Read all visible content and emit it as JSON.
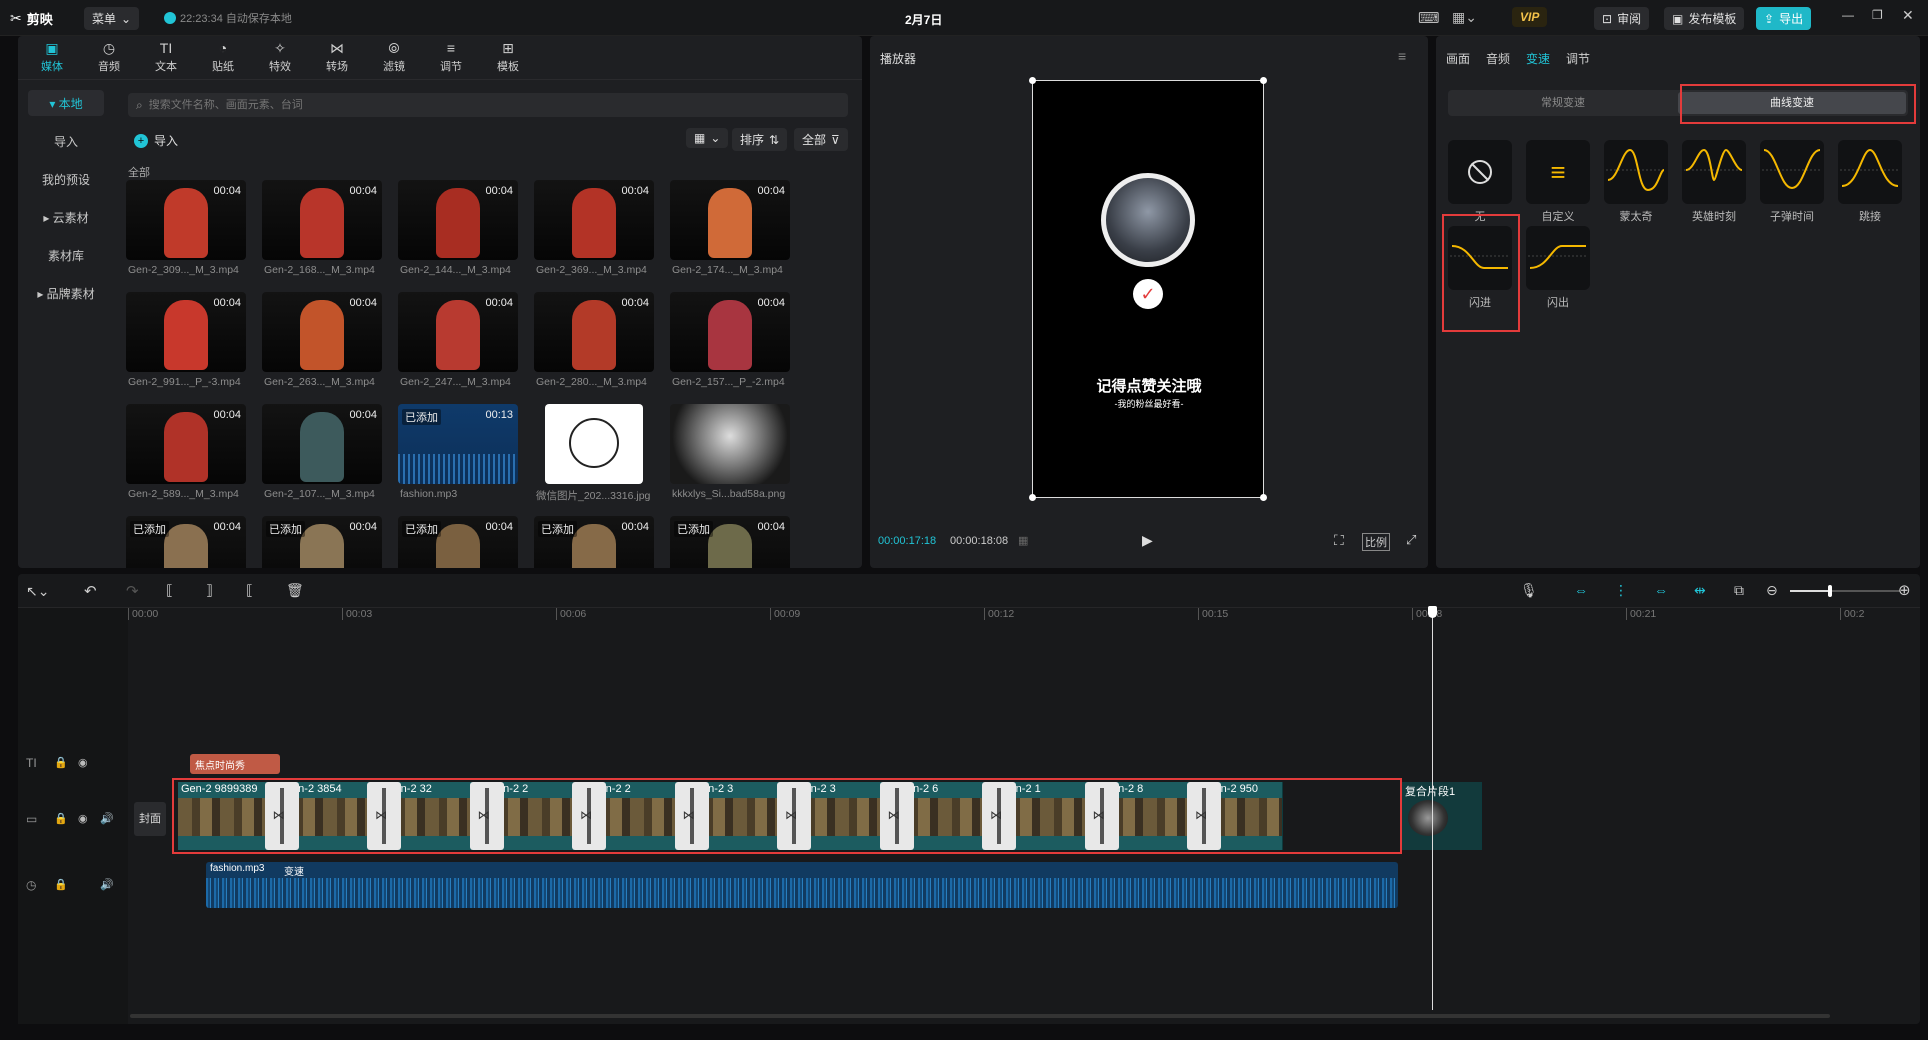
{
  "app": {
    "logo": "剪映",
    "menu": "菜单",
    "autosave": "22:23:34 自动保存本地",
    "project": "2月7日",
    "vip": "VIP",
    "review": "审阅",
    "publish": "发布模板",
    "export": "导出"
  },
  "tabs": [
    {
      "label": "媒体",
      "icon": "media-icon"
    },
    {
      "label": "音频",
      "icon": "audio-icon"
    },
    {
      "label": "文本",
      "icon": "text-icon"
    },
    {
      "label": "贴纸",
      "icon": "sticker-icon"
    },
    {
      "label": "特效",
      "icon": "effects-icon"
    },
    {
      "label": "转场",
      "icon": "transition-icon"
    },
    {
      "label": "滤镜",
      "icon": "filter-icon"
    },
    {
      "label": "调节",
      "icon": "adjust-icon"
    },
    {
      "label": "模板",
      "icon": "template-icon"
    }
  ],
  "tab_icons": [
    "▣",
    "◷",
    "TI",
    "◔",
    "✧",
    "⋈",
    "⦾",
    "≡",
    "⊞"
  ],
  "left_nav": [
    "▾ 本地",
    "导入",
    "我的预设",
    "▸ 云素材",
    "素材库",
    "▸ 品牌素材"
  ],
  "search": {
    "placeholder": "搜索文件名称、画面元素、台词"
  },
  "import_label": "导入",
  "sort_label": "排序",
  "all_label": "全部",
  "section_all": "全部",
  "media": [
    {
      "name": "Gen-2_309..._M_3.mp4",
      "dur": "00:04",
      "added": "",
      "col": "#c03a2a"
    },
    {
      "name": "Gen-2_168..._M_3.mp4",
      "dur": "00:04",
      "added": "",
      "col": "#b8352a"
    },
    {
      "name": "Gen-2_144..._M_3.mp4",
      "dur": "00:04",
      "added": "",
      "col": "#a82d22"
    },
    {
      "name": "Gen-2_369..._M_3.mp4",
      "dur": "00:04",
      "added": "",
      "col": "#b33326"
    },
    {
      "name": "Gen-2_174..._M_3.mp4",
      "dur": "00:04",
      "added": "",
      "col": "#d06a38"
    },
    {
      "name": "Gen-2_991..._P_-3.mp4",
      "dur": "00:04",
      "added": "",
      "col": "#c8382c"
    },
    {
      "name": "Gen-2_263..._M_3.mp4",
      "dur": "00:04",
      "added": "",
      "col": "#c2542a"
    },
    {
      "name": "Gen-2_247..._M_3.mp4",
      "dur": "00:04",
      "added": "",
      "col": "#b83a30"
    },
    {
      "name": "Gen-2_280..._M_3.mp4",
      "dur": "00:04",
      "added": "",
      "col": "#b33a28"
    },
    {
      "name": "Gen-2_157..._P_-2.mp4",
      "dur": "00:04",
      "added": "",
      "col": "#a83540"
    },
    {
      "name": "Gen-2_589..._M_3.mp4",
      "dur": "00:04",
      "added": "",
      "col": "#b03228"
    },
    {
      "name": "Gen-2_107..._M_3.mp4",
      "dur": "00:04",
      "added": "",
      "col": "#3d5a5c"
    },
    {
      "name": "fashion.mp3",
      "dur": "00:13",
      "added": "已添加",
      "col": "audio"
    },
    {
      "name": "微信图片_202...3316.jpg",
      "dur": "",
      "added": "",
      "col": "sketch"
    },
    {
      "name": "kkkxlys_Si...bad58a.png",
      "dur": "",
      "added": "",
      "col": "dog"
    },
    {
      "name": "",
      "dur": "00:04",
      "added": "已添加",
      "col": "#8a7050"
    },
    {
      "name": "",
      "dur": "00:04",
      "added": "已添加",
      "col": "#8a7555"
    },
    {
      "name": "",
      "dur": "00:04",
      "added": "已添加",
      "col": "#7a6040"
    },
    {
      "name": "",
      "dur": "00:04",
      "added": "已添加",
      "col": "#866a48"
    },
    {
      "name": "",
      "dur": "00:04",
      "added": "已添加",
      "col": "#6d6a4a"
    }
  ],
  "player": {
    "title": "播放器",
    "current": "00:00:17:18",
    "total": "00:00:18:08",
    "caption": "记得点赞关注哦",
    "subcaption": "-我的粉丝最好看-",
    "ratio": "比例"
  },
  "right": {
    "tabs": [
      "画面",
      "音频",
      "变速",
      "调节"
    ],
    "active_tab": "变速",
    "subtabs": [
      "常规变速",
      "曲线变速"
    ],
    "presets": [
      {
        "label": "无",
        "icon": "none-icon"
      },
      {
        "label": "自定义",
        "icon": "custom-icon"
      },
      {
        "label": "蒙太奇",
        "icon": "montage-icon"
      },
      {
        "label": "英雄时刻",
        "icon": "hero-icon"
      },
      {
        "label": "子弹时间",
        "icon": "bullet-icon"
      },
      {
        "label": "跳接",
        "icon": "jump-icon"
      },
      {
        "label": "闪进",
        "icon": "flash-in-icon"
      },
      {
        "label": "闪出",
        "icon": "flash-out-icon"
      }
    ]
  },
  "timeline": {
    "ruler": [
      "00:00",
      "00:03",
      "00:06",
      "00:09",
      "00:12",
      "00:15",
      "00:18",
      "00:21",
      "00:2"
    ],
    "text_clip": "焦点时尚秀",
    "cover": "封面",
    "clips": [
      "Gen-2 9899389",
      "Gen-2 3854",
      "Gen-2 32",
      "Gen-2 2",
      "Gen-2 2",
      "Gen-2 3",
      "Gen-2 3",
      "Gen-2 6",
      "Gen-2 1",
      "Gen-2 8",
      "Gen-2 950"
    ],
    "compound": "复合片段1",
    "audio_name": "fashion.mp3",
    "audio_effect": "变速"
  },
  "colors": {
    "accent": "#21c4d6",
    "highlight": "#e33b3b",
    "curve": "#f5b800"
  }
}
